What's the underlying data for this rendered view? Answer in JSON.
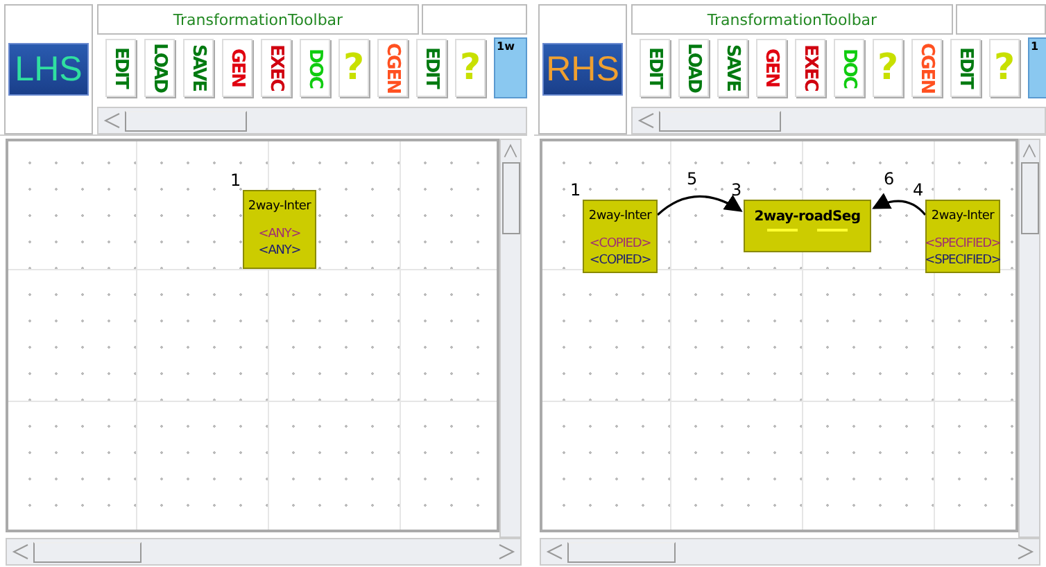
{
  "panes": [
    {
      "logo": {
        "text": "LHS",
        "color": "#30e0a0"
      },
      "toolbar_title": "TransformationToolbar",
      "buttons": [
        {
          "kind": "vertical",
          "label": "EDIT",
          "color": "#007a10"
        },
        {
          "kind": "vertical",
          "label": "LOAD",
          "color": "#007a10"
        },
        {
          "kind": "vertical",
          "label": "SAVE",
          "color": "#007a10"
        },
        {
          "kind": "vertical",
          "label": "GEN",
          "color": "#e00010"
        },
        {
          "kind": "vertical",
          "label": "EXEC",
          "color": "#d00010"
        },
        {
          "kind": "vertical",
          "label": "DOC",
          "color": "#10cc10"
        },
        {
          "kind": "glyph",
          "label": "?",
          "color": "#c8e000"
        },
        {
          "kind": "vertical",
          "label": "CGEN",
          "color": "#ff5020"
        },
        {
          "kind": "vertical",
          "label": "EDIT",
          "color": "#007a10"
        },
        {
          "kind": "glyph",
          "label": "?",
          "color": "#c8e000"
        },
        {
          "kind": "tile",
          "label": "1w"
        }
      ],
      "nodes": [
        {
          "number": "1",
          "title": "2way-Inter",
          "bold": false,
          "attributes": [
            {
              "kind": "text",
              "text": "<ANY>",
              "color": "#a03070"
            },
            {
              "kind": "text",
              "text": "<ANY>",
              "color": "#202070"
            }
          ]
        }
      ]
    },
    {
      "logo": {
        "text": "RHS",
        "color": "#f0a030"
      },
      "toolbar_title": "TransformationToolbar",
      "buttons": [
        {
          "kind": "vertical",
          "label": "EDIT",
          "color": "#007a10"
        },
        {
          "kind": "vertical",
          "label": "LOAD",
          "color": "#007a10"
        },
        {
          "kind": "vertical",
          "label": "SAVE",
          "color": "#007a10"
        },
        {
          "kind": "vertical",
          "label": "GEN",
          "color": "#e00010"
        },
        {
          "kind": "vertical",
          "label": "EXEC",
          "color": "#d00010"
        },
        {
          "kind": "vertical",
          "label": "DOC",
          "color": "#10cc10"
        },
        {
          "kind": "glyph",
          "label": "?",
          "color": "#c8e000"
        },
        {
          "kind": "vertical",
          "label": "CGEN",
          "color": "#ff5020"
        },
        {
          "kind": "vertical",
          "label": "EDIT",
          "color": "#007a10"
        },
        {
          "kind": "glyph",
          "label": "?",
          "color": "#c8e000"
        },
        {
          "kind": "tile",
          "label": "1"
        }
      ],
      "nodes": [
        {
          "number": "1",
          "title": "2way-Inter",
          "bold": false,
          "attributes": [
            {
              "kind": "text",
              "text": "<COPIED>",
              "color": "#a03070"
            },
            {
              "kind": "text",
              "text": "<COPIED>",
              "color": "#202070"
            }
          ]
        },
        {
          "number": "3",
          "title": "2way-roadSeg",
          "bold": true,
          "attributes": [
            {
              "kind": "blank"
            },
            {
              "kind": "blank"
            }
          ]
        },
        {
          "number": "4",
          "title": "2way-Inter",
          "bold": false,
          "attributes": [
            {
              "kind": "text",
              "text": "<SPECIFIED>",
              "color": "#a03070"
            },
            {
              "kind": "text",
              "text": "<SPECIFIED>",
              "color": "#202070"
            }
          ]
        }
      ],
      "edges": [
        {
          "number": "5"
        },
        {
          "number": "6"
        }
      ]
    }
  ]
}
